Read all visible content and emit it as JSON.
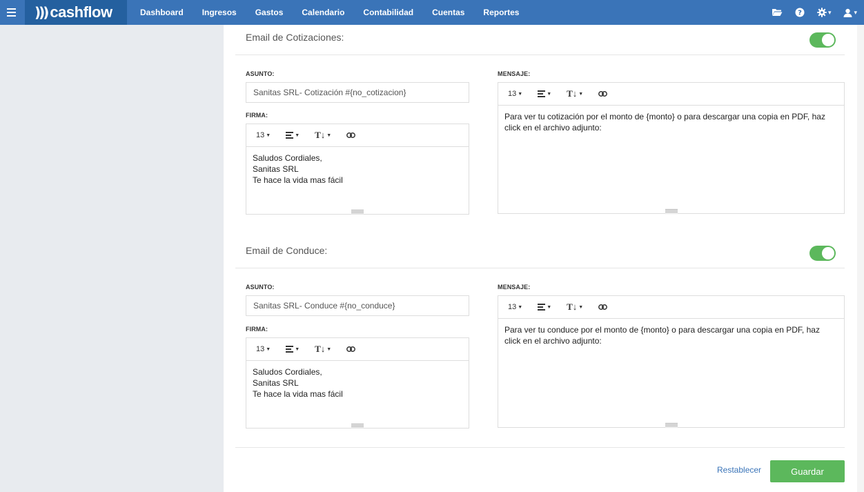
{
  "nav": {
    "brand": "cashflow",
    "links": [
      "Dashboard",
      "Ingresos",
      "Gastos",
      "Calendario",
      "Contabilidad",
      "Cuentas",
      "Reportes"
    ]
  },
  "icons": {
    "menu": "hamburger-icon",
    "folder": "folder-open-icon",
    "help": "question-circle-icon",
    "settings": "gear-icon",
    "user": "user-icon",
    "font_size": "font-size-icon",
    "align": "align-icon",
    "text_style": "text-style-icon",
    "link": "link-icon"
  },
  "colors": {
    "nav": "#3a74b8",
    "brand_bg": "#24609f",
    "toggle_on": "#5cb85c",
    "save": "#5cb85c",
    "link": "#3a74b8"
  },
  "editor_toolbar": {
    "font_size": "13"
  },
  "sections": [
    {
      "title": "Email de Cotizaciones:",
      "enabled": true,
      "asunto_label": "ASUNTO:",
      "asunto_value": "Sanitas SRL- Cotización  #{no_cotizacion}",
      "firma_label": "FIRMA:",
      "firma": "Saludos Cordiales,\nSanitas SRL\nTe hace la vida mas fácil",
      "mensaje_label": "MENSAJE:",
      "mensaje": "Para ver tu cotización por el monto de {monto} o para descargar una copia en PDF, haz click en el archivo adjunto:"
    },
    {
      "title": "Email de Conduce:",
      "enabled": true,
      "asunto_label": "ASUNTO:",
      "asunto_value": "Sanitas SRL- Conduce  #{no_conduce}",
      "firma_label": "FIRMA:",
      "firma": "Saludos Cordiales,\nSanitas SRL\nTe hace la vida mas fácil",
      "mensaje_label": "MENSAJE:",
      "mensaje": "Para ver tu conduce por el monto de {monto} o para descargar una copia en PDF, haz click en el archivo adjunto:"
    }
  ],
  "actions": {
    "reset": "Restablecer",
    "save": "Guardar"
  }
}
